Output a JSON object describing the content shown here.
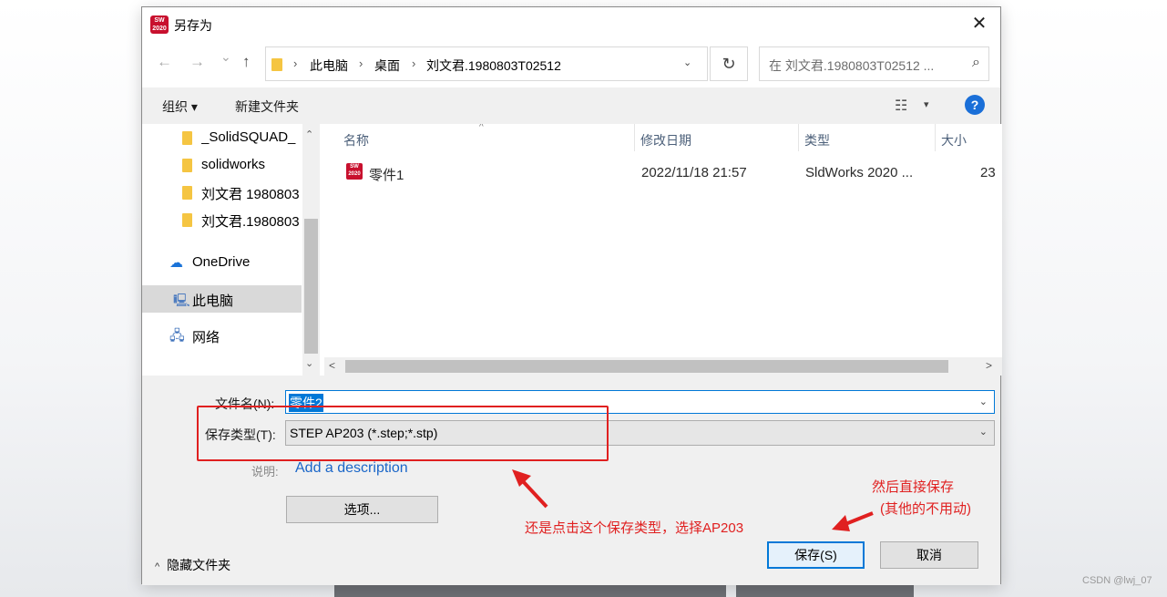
{
  "dialog": {
    "title": "另存为",
    "app_icon_text": "SW 2020",
    "close_glyph": "✕"
  },
  "nav": {
    "back_glyph": "←",
    "forward_glyph": "→",
    "history_glyph": "⌄",
    "up_glyph": "↑"
  },
  "address": {
    "crumbs": [
      "此电脑",
      "桌面",
      "刘文君.1980803T02512"
    ],
    "separator": "›",
    "dropdown_glyph": "⌄",
    "refresh_glyph": "↻"
  },
  "search": {
    "placeholder": "在 刘文君.1980803T02512 ...",
    "icon_glyph": "⌕"
  },
  "toolbar": {
    "organize_label": "组织 ▾",
    "new_folder_label": "新建文件夹",
    "view_glyph": "☷",
    "view_dropdown_glyph": "▾",
    "help_glyph": "?"
  },
  "sidebar": {
    "items": [
      {
        "label": "_SolidSQUAD_"
      },
      {
        "label": "solidworks"
      },
      {
        "label": "刘文君 1980803"
      },
      {
        "label": "刘文君.1980803"
      },
      {
        "label": "OneDrive",
        "icon": "☁"
      },
      {
        "label": "此电脑",
        "icon": "🖳"
      },
      {
        "label": "网络",
        "icon": "🖧"
      }
    ],
    "scroll_up": "⌃",
    "scroll_down": "⌄"
  },
  "files": {
    "columns": {
      "name": "名称",
      "modified": "修改日期",
      "type": "类型",
      "size": "大小"
    },
    "sort_caret": "^",
    "rows": [
      {
        "name": "零件1",
        "modified": "2022/11/18 21:57",
        "type": "SldWorks 2020 ...",
        "size": "23",
        "icon_text": "SW 2020"
      }
    ],
    "scroll_left": "<",
    "scroll_right": ">"
  },
  "form": {
    "filename_label": "文件名(N):",
    "filename_value": "零件2",
    "filetype_label": "保存类型(T):",
    "filetype_value": "STEP AP203 (*.step;*.stp)",
    "dropdown_glyph": "⌄",
    "desc_label": "说明:",
    "desc_link": "Add a description",
    "options_label": "选项...",
    "save_label": "保存(S)",
    "cancel_label": "取消",
    "hide_folders_caret": "^",
    "hide_folders_label": "隐藏文件夹"
  },
  "annotations": {
    "note_filetype": "还是点击这个保存类型，选择AP203",
    "note_save_line1": "然后直接保存",
    "note_save_line2": "(其他的不用动)",
    "color": "#e02020"
  },
  "watermark": "CSDN @lwj_07"
}
